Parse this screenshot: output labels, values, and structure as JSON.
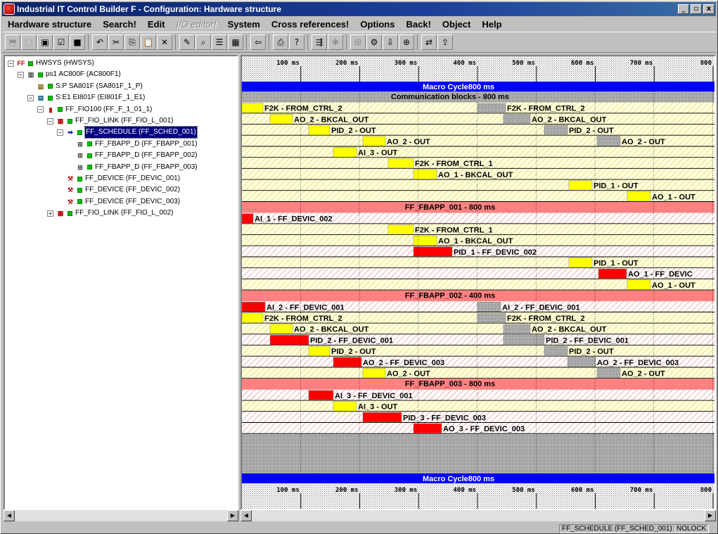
{
  "window": {
    "title": "Industrial IT Control Builder F - Configuration: Hardware structure",
    "buttons": {
      "min": "_",
      "max": "▫",
      "close": "x"
    }
  },
  "menu": [
    "Hardware structure",
    "Search!",
    "Edit",
    "I/O editor!",
    "System",
    "Cross references!",
    "Options",
    "Back!",
    "Object",
    "Help"
  ],
  "menu_disabled": [
    "I/O editor!"
  ],
  "toolbar": [
    "open-icon",
    "new-icon",
    "save-icon",
    "check-icon",
    "stop-icon",
    "undo-icon",
    "cut-icon",
    "copy-icon",
    "paste-icon",
    "delete-icon",
    "edit-icon",
    "find-icon",
    "list-icon",
    "grid-icon",
    "back-icon",
    "print-icon",
    "help-icon",
    "merge-icon",
    "star-icon",
    "hw-icon",
    "commission-icon",
    "download-icon",
    "network-icon",
    "compare-icon",
    "export-icon"
  ],
  "tree": [
    {
      "label": "HWSYS (HWSYS)",
      "indent": 0,
      "exp": "−",
      "icon": "ff-root-icon",
      "id": "hwsys"
    },
    {
      "label": "ps1  AC800F (AC800F1)",
      "indent": 1,
      "exp": "−",
      "icon": "rack-icon",
      "id": "ps1"
    },
    {
      "label": "S:P  SA801F (SA801F_1_P)",
      "indent": 2,
      "exp": "",
      "icon": "power-supply-icon",
      "id": "sa801f"
    },
    {
      "label": "S:E1  EI801F (EI801F_1_E1)",
      "indent": 2,
      "exp": "−",
      "icon": "ethernet-icon",
      "id": "ei801f"
    },
    {
      "label": "FF_FIO100 (FF_F_1_01_1)",
      "indent": 3,
      "exp": "−",
      "icon": "fio-icon",
      "id": "fio100"
    },
    {
      "label": "FF_FIO_LINK (FF_FIO_L_001)",
      "indent": 4,
      "exp": "−",
      "icon": "link-icon",
      "id": "link001"
    },
    {
      "label": "FF_SCHEDULE (FF_SCHED_001)",
      "indent": 5,
      "exp": "−",
      "icon": "arrow-icon",
      "id": "sched001",
      "selected": true
    },
    {
      "label": "FF_FBAPP_D (FF_FBAPP_001)",
      "indent": 6,
      "exp": "",
      "icon": "fbapp-icon",
      "id": "fbapp001"
    },
    {
      "label": "FF_FBAPP_D (FF_FBAPP_002)",
      "indent": 6,
      "exp": "",
      "icon": "fbapp-icon",
      "id": "fbapp002"
    },
    {
      "label": "FF_FBAPP_D (FF_FBAPP_003)",
      "indent": 6,
      "exp": "",
      "icon": "fbapp-icon",
      "id": "fbapp003"
    },
    {
      "label": "FF_DEVICE (FF_DEVIC_001)",
      "indent": 5,
      "exp": "",
      "icon": "device-icon",
      "id": "dev001"
    },
    {
      "label": "FF_DEVICE (FF_DEVIC_002)",
      "indent": 5,
      "exp": "",
      "icon": "device-icon",
      "id": "dev002"
    },
    {
      "label": "FF_DEVICE (FF_DEVIC_003)",
      "indent": 5,
      "exp": "",
      "icon": "device-icon",
      "id": "dev003"
    },
    {
      "label": "FF_FIO_LINK (FF_FIO_L_002)",
      "indent": 4,
      "exp": "+",
      "icon": "link-icon",
      "id": "link002"
    }
  ],
  "schedule": {
    "ruler": [
      "100 ms",
      "200 ms",
      "300 ms",
      "400 ms",
      "500 ms",
      "600 ms",
      "700 ms",
      "800"
    ],
    "macro_cycle": "Macro Cycle800 ms",
    "colors": {
      "ruler_bg": "#ffffff",
      "macro": "#0000ff",
      "comm": "#a0a0a0",
      "yellow_bar": "#ffff00",
      "red_bar": "#ff0000",
      "gray_bar": "#c0c0c0",
      "row_bg_yellow": "#ffffc0",
      "row_bg_red": "#ffc0c0",
      "group_header": "#ff8080"
    },
    "rows": [
      {
        "kind": "comm",
        "label": "Communication blocks - 800 ms"
      },
      {
        "kind": "y",
        "bars": [
          [
            0,
            30,
            "y"
          ],
          [
            335,
            40,
            "g"
          ]
        ],
        "labels": [
          [
            0,
            "F2K - FROM_CTRL_2"
          ],
          [
            335,
            "F2K - FROM_CTRL_2"
          ]
        ]
      },
      {
        "kind": "y",
        "bars": [
          [
            40,
            32,
            "y"
          ],
          [
            372,
            38,
            "g"
          ]
        ],
        "labels": [
          [
            40,
            "AO_2 - BKCAL_OUT"
          ],
          [
            372,
            "AO_2 - BKCAL_OUT"
          ]
        ]
      },
      {
        "kind": "y",
        "bars": [
          [
            95,
            30,
            "y"
          ],
          [
            430,
            33,
            "g"
          ]
        ],
        "labels": [
          [
            95,
            "PID_2 - OUT"
          ],
          [
            430,
            "PID_2 - OUT"
          ]
        ]
      },
      {
        "kind": "y",
        "bars": [
          [
            172,
            32,
            "y"
          ],
          [
            505,
            33,
            "g"
          ]
        ],
        "labels": [
          [
            172,
            "AO_2 - OUT"
          ],
          [
            505,
            "AO_2 - OUT"
          ]
        ]
      },
      {
        "kind": "y",
        "bars": [
          [
            130,
            33,
            "y"
          ]
        ],
        "labels": [
          [
            130,
            "AI_3 - OUT"
          ]
        ]
      },
      {
        "kind": "y",
        "bars": [
          [
            208,
            36,
            "y"
          ]
        ],
        "labels": [
          [
            208,
            "F2K - FROM_CTRL_1"
          ]
        ]
      },
      {
        "kind": "y",
        "bars": [
          [
            244,
            33,
            "y"
          ]
        ],
        "labels": [
          [
            244,
            "AO_1 - BKCAL_OUT"
          ]
        ]
      },
      {
        "kind": "y",
        "bars": [
          [
            465,
            33,
            "y"
          ]
        ],
        "labels": [
          [
            465,
            "PID_1 - OUT"
          ]
        ]
      },
      {
        "kind": "y",
        "bars": [
          [
            548,
            33,
            "y"
          ]
        ],
        "labels": [
          [
            548,
            "AO_1 - OUT"
          ]
        ]
      },
      {
        "kind": "hdr",
        "label": "FF_FBAPP_001 - 800 ms"
      },
      {
        "kind": "r",
        "bars": [
          [
            0,
            16,
            "r"
          ]
        ],
        "labels": [
          [
            0,
            "AI_1 - FF_DEVIC_002"
          ]
        ]
      },
      {
        "kind": "y",
        "bars": [
          [
            208,
            36,
            "y"
          ]
        ],
        "labels": [
          [
            208,
            "F2K - FROM_CTRL_1"
          ]
        ]
      },
      {
        "kind": "y",
        "bars": [
          [
            244,
            33,
            "y"
          ]
        ],
        "labels": [
          [
            244,
            "AO_1 - BKCAL_OUT"
          ]
        ]
      },
      {
        "kind": "r",
        "bars": [
          [
            244,
            55,
            "r"
          ]
        ],
        "labels": [
          [
            244,
            "PID_1 - FF_DEVIC_002"
          ]
        ]
      },
      {
        "kind": "y",
        "bars": [
          [
            465,
            33,
            "y"
          ]
        ],
        "labels": [
          [
            465,
            "PID_1 - OUT"
          ]
        ]
      },
      {
        "kind": "r",
        "bars": [
          [
            507,
            40,
            "r"
          ]
        ],
        "labels": [
          [
            507,
            "AO_1 - FF_DEVIC"
          ]
        ]
      },
      {
        "kind": "y",
        "bars": [
          [
            548,
            33,
            "y"
          ]
        ],
        "labels": [
          [
            548,
            "AO_1 - OUT"
          ]
        ]
      },
      {
        "kind": "hdr",
        "label": "FF_FBAPP_002 - 400 ms"
      },
      {
        "kind": "r",
        "bars": [
          [
            0,
            33,
            "r"
          ],
          [
            335,
            33,
            "g"
          ]
        ],
        "labels": [
          [
            0,
            "AI_2 - FF_DEVIC_001"
          ],
          [
            335,
            "AI_2 - FF_DEVIC_001"
          ]
        ]
      },
      {
        "kind": "y",
        "bars": [
          [
            0,
            30,
            "y"
          ],
          [
            335,
            40,
            "g"
          ]
        ],
        "labels": [
          [
            0,
            "F2K - FROM_CTRL_2"
          ],
          [
            335,
            "F2K - FROM_CTRL_2"
          ]
        ]
      },
      {
        "kind": "y",
        "bars": [
          [
            40,
            32,
            "y"
          ],
          [
            372,
            38,
            "g"
          ]
        ],
        "labels": [
          [
            40,
            "AO_2 - BKCAL_OUT"
          ],
          [
            372,
            "AO_2 - BKCAL_OUT"
          ]
        ]
      },
      {
        "kind": "r",
        "bars": [
          [
            40,
            55,
            "r"
          ],
          [
            372,
            58,
            "g"
          ]
        ],
        "labels": [
          [
            40,
            "PID_2 - FF_DEVIC_001"
          ],
          [
            372,
            "PID_2 - FF_DEVIC_001"
          ]
        ]
      },
      {
        "kind": "y",
        "bars": [
          [
            95,
            30,
            "y"
          ],
          [
            430,
            33,
            "g"
          ]
        ],
        "labels": [
          [
            95,
            "PID_2 - OUT"
          ],
          [
            430,
            "PID_2 - OUT"
          ]
        ]
      },
      {
        "kind": "r",
        "bars": [
          [
            130,
            40,
            "r"
          ],
          [
            463,
            40,
            "g"
          ]
        ],
        "labels": [
          [
            130,
            "AO_2 - FF_DEVIC_003"
          ],
          [
            463,
            "AO_2 - FF_DEVIC_003"
          ]
        ]
      },
      {
        "kind": "y",
        "bars": [
          [
            172,
            32,
            "y"
          ],
          [
            505,
            33,
            "g"
          ]
        ],
        "labels": [
          [
            172,
            "AO_2 - OUT"
          ],
          [
            505,
            "AO_2 - OUT"
          ]
        ]
      },
      {
        "kind": "hdr",
        "label": "FF_FBAPP_003 - 800 ms"
      },
      {
        "kind": "r",
        "bars": [
          [
            95,
            35,
            "r"
          ]
        ],
        "labels": [
          [
            95,
            "AI_3 - FF_DEVIC_001"
          ]
        ]
      },
      {
        "kind": "y",
        "bars": [
          [
            130,
            33,
            "y"
          ]
        ],
        "labels": [
          [
            130,
            "AI_3 - OUT"
          ]
        ]
      },
      {
        "kind": "r",
        "bars": [
          [
            172,
            55,
            "r"
          ]
        ],
        "labels": [
          [
            172,
            "PID_3 - FF_DEVIC_003"
          ]
        ]
      },
      {
        "kind": "r",
        "bars": [
          [
            244,
            40,
            "r"
          ]
        ],
        "labels": [
          [
            244,
            "AO_3 - FF_DEVIC_003"
          ]
        ]
      },
      {
        "kind": "empty"
      },
      {
        "kind": "empty"
      },
      {
        "kind": "empty"
      },
      {
        "kind": "empty"
      }
    ]
  },
  "status": {
    "object": "FF_SCHEDULE (FF_SCHED_001)",
    "lock": "NOLOCK"
  }
}
